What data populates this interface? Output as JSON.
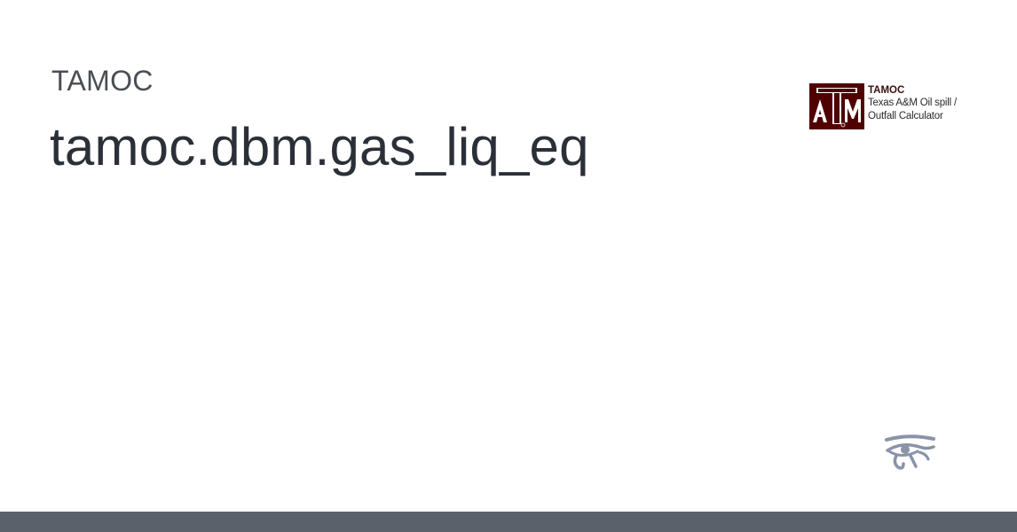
{
  "header": {
    "project_name": "TAMOC",
    "title": "tamoc.dbm.gas_liq_eq"
  },
  "logo": {
    "mark_letters": "ATM",
    "title": "TAMOC",
    "subtitle": "Texas A&M Oil spill /\nOutfall Calculator",
    "brand_color": "#500000"
  },
  "decorations": {
    "eye_icon": "eye-of-horus-icon",
    "eye_color": "#8a93a8",
    "footer_color": "#5b616b"
  }
}
